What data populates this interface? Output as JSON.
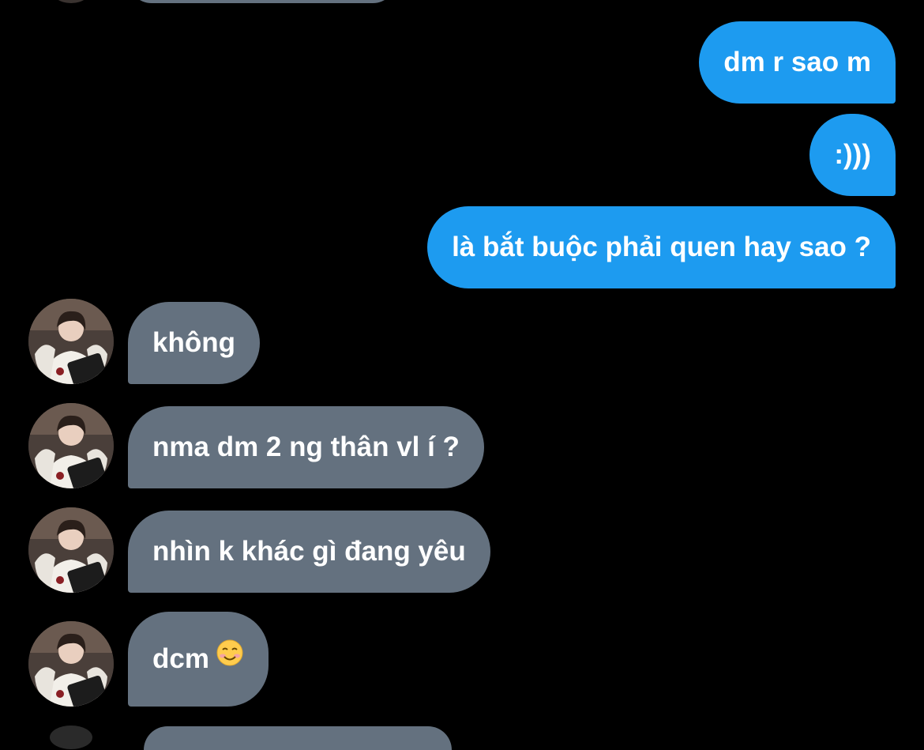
{
  "conversation": {
    "sent": [
      {
        "text": "dm r sao m"
      },
      {
        "text": ":)))"
      },
      {
        "text": "là bắt buộc phải quen hay sao ?"
      }
    ],
    "received": [
      {
        "text": "không"
      },
      {
        "text": "nma dm 2 ng thân vl í ?"
      },
      {
        "text": "nhìn k khác gì đang yêu"
      },
      {
        "text": "dcm",
        "emoji": "☺️"
      }
    ]
  },
  "colors": {
    "background": "#000000",
    "sent_bubble": "#1d9bf0",
    "received_bubble": "#64717f",
    "text": "#ffffff"
  },
  "icons": {
    "avatar": "user-avatar-photo",
    "emoji": "smiling-face-emoji"
  }
}
